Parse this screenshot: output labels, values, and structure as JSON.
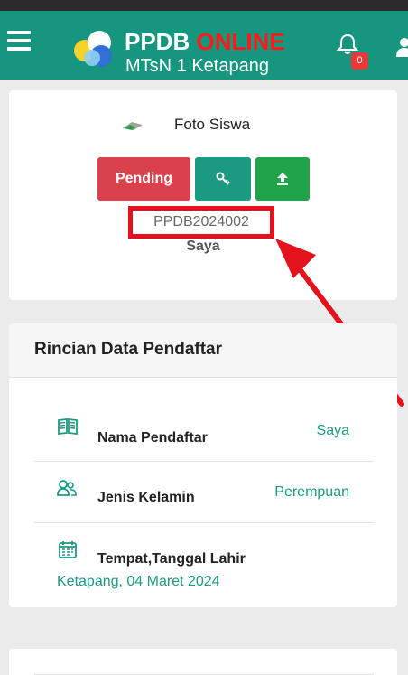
{
  "header": {
    "brand_main": "PPDB",
    "brand_accent": "ONLINE",
    "school": "MTsN 1 Ketapang",
    "notification_count": "0"
  },
  "profile": {
    "photo_label": "Foto Siswa",
    "status_label": "Pending",
    "registration_number": "PPDB2024002",
    "name": "Saya"
  },
  "details": {
    "title": "Rincian Data Pendaftar",
    "rows": [
      {
        "icon": "book-icon",
        "label": "Nama Pendaftar",
        "value": "Saya"
      },
      {
        "icon": "users-icon",
        "label": "Jenis Kelamin",
        "value": "Perempuan"
      },
      {
        "icon": "calendar-icon",
        "label": "Tempat,Tanggal Lahir",
        "value": "Ketapang, 04 Maret 2024"
      }
    ]
  },
  "colors": {
    "navbar": "#16967f",
    "pending": "#d9414c",
    "key_button": "#1b9a82",
    "upload_button": "#21a34a",
    "highlight": "#e4121c",
    "value_text": "#1b9a82"
  }
}
